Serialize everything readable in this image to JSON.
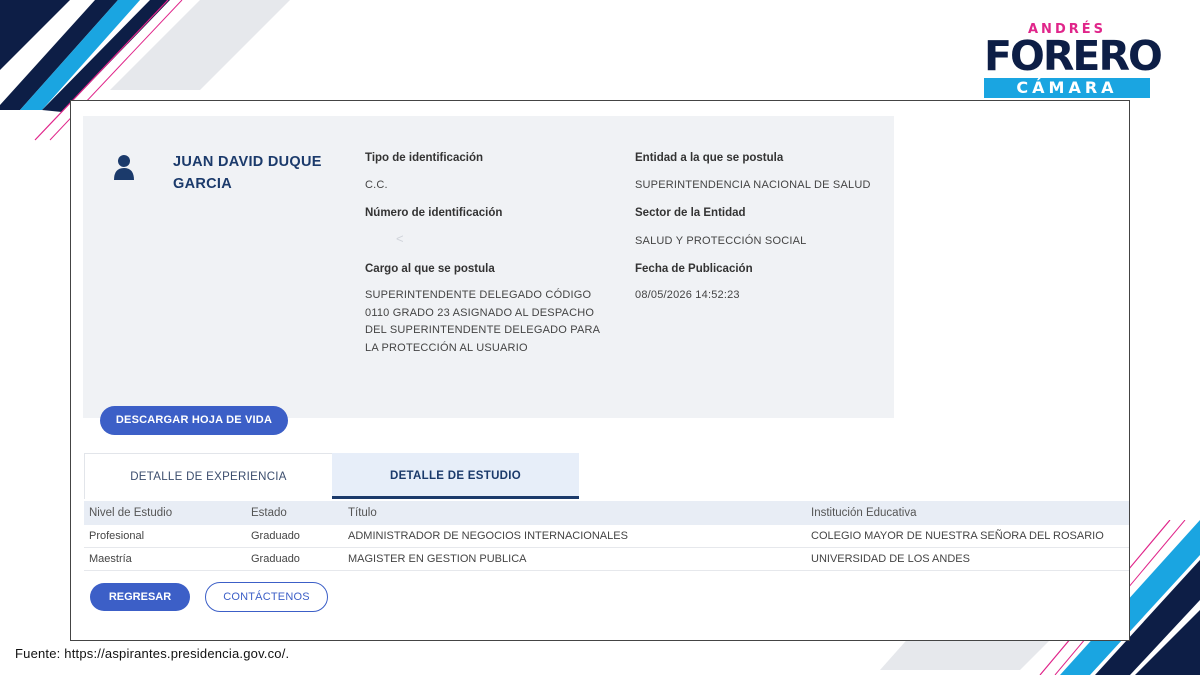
{
  "logo": {
    "top": "ANDRÉS",
    "middle": "FORERO",
    "bottom": "CÁMARA"
  },
  "profile": {
    "name": "JUAN DAVID DUQUE GARCIA",
    "id_type_label": "Tipo de identificación",
    "id_type_value": "C.C.",
    "id_number_label": "Número de identificación",
    "position_label": "Cargo al que se postula",
    "position_value": "SUPERINTENDENTE DELEGADO CÓDIGO 0110 GRADO 23 ASIGNADO AL DESPACHO DEL SUPERINTENDENTE DELEGADO PARA LA PROTECCIÓN AL USUARIO",
    "entity_label": "Entidad a la que se postula",
    "entity_value": "SUPERINTENDENCIA NACIONAL DE SALUD",
    "sector_label": "Sector de la Entidad",
    "sector_value": "SALUD Y PROTECCIÓN SOCIAL",
    "date_label": "Fecha de Publicación",
    "date_value": "08/05/2026 14:52:23",
    "download_label": "DESCARGAR HOJA DE VIDA"
  },
  "tabs": {
    "experience": "DETALLE DE EXPERIENCIA",
    "study": "DETALLE DE ESTUDIO"
  },
  "table": {
    "headers": [
      "Nivel de Estudio",
      "Estado",
      "Título",
      "Institución Educativa"
    ],
    "rows": [
      [
        "Profesional",
        "Graduado",
        "ADMINISTRADOR DE NEGOCIOS INTERNACIONALES",
        "COLEGIO MAYOR DE NUESTRA SEÑORA DEL ROSARIO"
      ],
      [
        "Maestría",
        "Graduado",
        "MAGISTER EN GESTION PUBLICA",
        "UNIVERSIDAD DE LOS ANDES"
      ]
    ]
  },
  "buttons": {
    "back": "REGRESAR",
    "contact": "CONTÁCTENOS"
  },
  "source": "Fuente: https://aspirantes.presidencia.gov.co/.",
  "colors": {
    "navy": "#1b3a6b",
    "accent": "#3c5fc7",
    "pink": "#e0258a",
    "cyan": "#1aa5e1"
  }
}
